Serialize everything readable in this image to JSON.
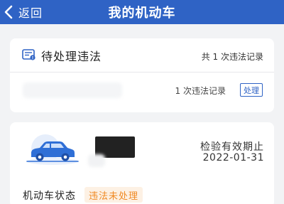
{
  "nav": {
    "back_label": "返回",
    "title": "我的机动车"
  },
  "violations": {
    "title": "待处理违法",
    "summary": "共 1 次违法记录",
    "row": {
      "count": "1 次违法记录",
      "action_label": "处理"
    }
  },
  "vehicle": {
    "valid_label": "检验有效期止",
    "valid_date": "2022-01-31",
    "status_label": "机动车状态",
    "status_badge": "违法未处理"
  },
  "colors": {
    "nav_bg": "#2f63c5",
    "accent": "#2f63c5",
    "status_text": "#f08a24",
    "status_bg": "#fdf1e4"
  },
  "icons": [
    "back-chevron-icon",
    "violation-doc-icon",
    "car-illustration"
  ]
}
